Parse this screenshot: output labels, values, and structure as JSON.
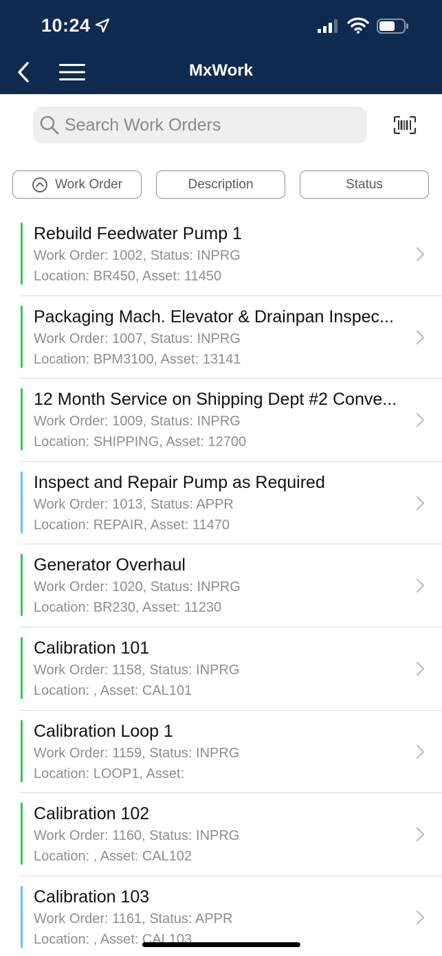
{
  "status_bar": {
    "time": "10:24"
  },
  "header": {
    "title": "MxWork"
  },
  "search": {
    "placeholder": "Search Work Orders",
    "value": ""
  },
  "sort_buttons": [
    {
      "label": "Work Order",
      "active": true
    },
    {
      "label": "Description"
    },
    {
      "label": "Status"
    }
  ],
  "colors": {
    "header_bg": "#0e2a4e",
    "inprg": "#34c759",
    "appr": "#5ac8fa"
  },
  "work_orders": [
    {
      "title": "Rebuild Feedwater Pump 1",
      "line1": "Work Order: 1002, Status: INPRG",
      "line2": "Location: BR450, Asset: 11450",
      "status": "INPRG"
    },
    {
      "title": "Packaging Mach. Elevator & Drainpan Inspec...",
      "line1": "Work Order: 1007, Status: INPRG",
      "line2": "Location: BPM3100, Asset: 13141",
      "status": "INPRG"
    },
    {
      "title": "12 Month Service on Shipping Dept #2 Conve...",
      "line1": "Work Order: 1009, Status: INPRG",
      "line2": "Location: SHIPPING, Asset: 12700",
      "status": "INPRG"
    },
    {
      "title": "Inspect and Repair Pump as Required",
      "line1": "Work Order: 1013, Status: APPR",
      "line2": "Location: REPAIR, Asset: 11470",
      "status": "APPR"
    },
    {
      "title": "Generator Overhaul",
      "line1": "Work Order: 1020, Status: INPRG",
      "line2": "Location: BR230, Asset: 11230",
      "status": "INPRG"
    },
    {
      "title": "Calibration 101",
      "line1": "Work Order: 1158, Status: INPRG",
      "line2": "Location: , Asset: CAL101",
      "status": "INPRG"
    },
    {
      "title": "Calibration Loop 1",
      "line1": "Work Order: 1159, Status: INPRG",
      "line2": "Location: LOOP1, Asset:",
      "status": "INPRG"
    },
    {
      "title": "Calibration 102",
      "line1": "Work Order: 1160, Status: INPRG",
      "line2": "Location: , Asset: CAL102",
      "status": "INPRG"
    },
    {
      "title": "Calibration 103",
      "line1": "Work Order: 1161, Status: APPR",
      "line2": "Location: , Asset: CAL103",
      "status": "APPR"
    }
  ]
}
